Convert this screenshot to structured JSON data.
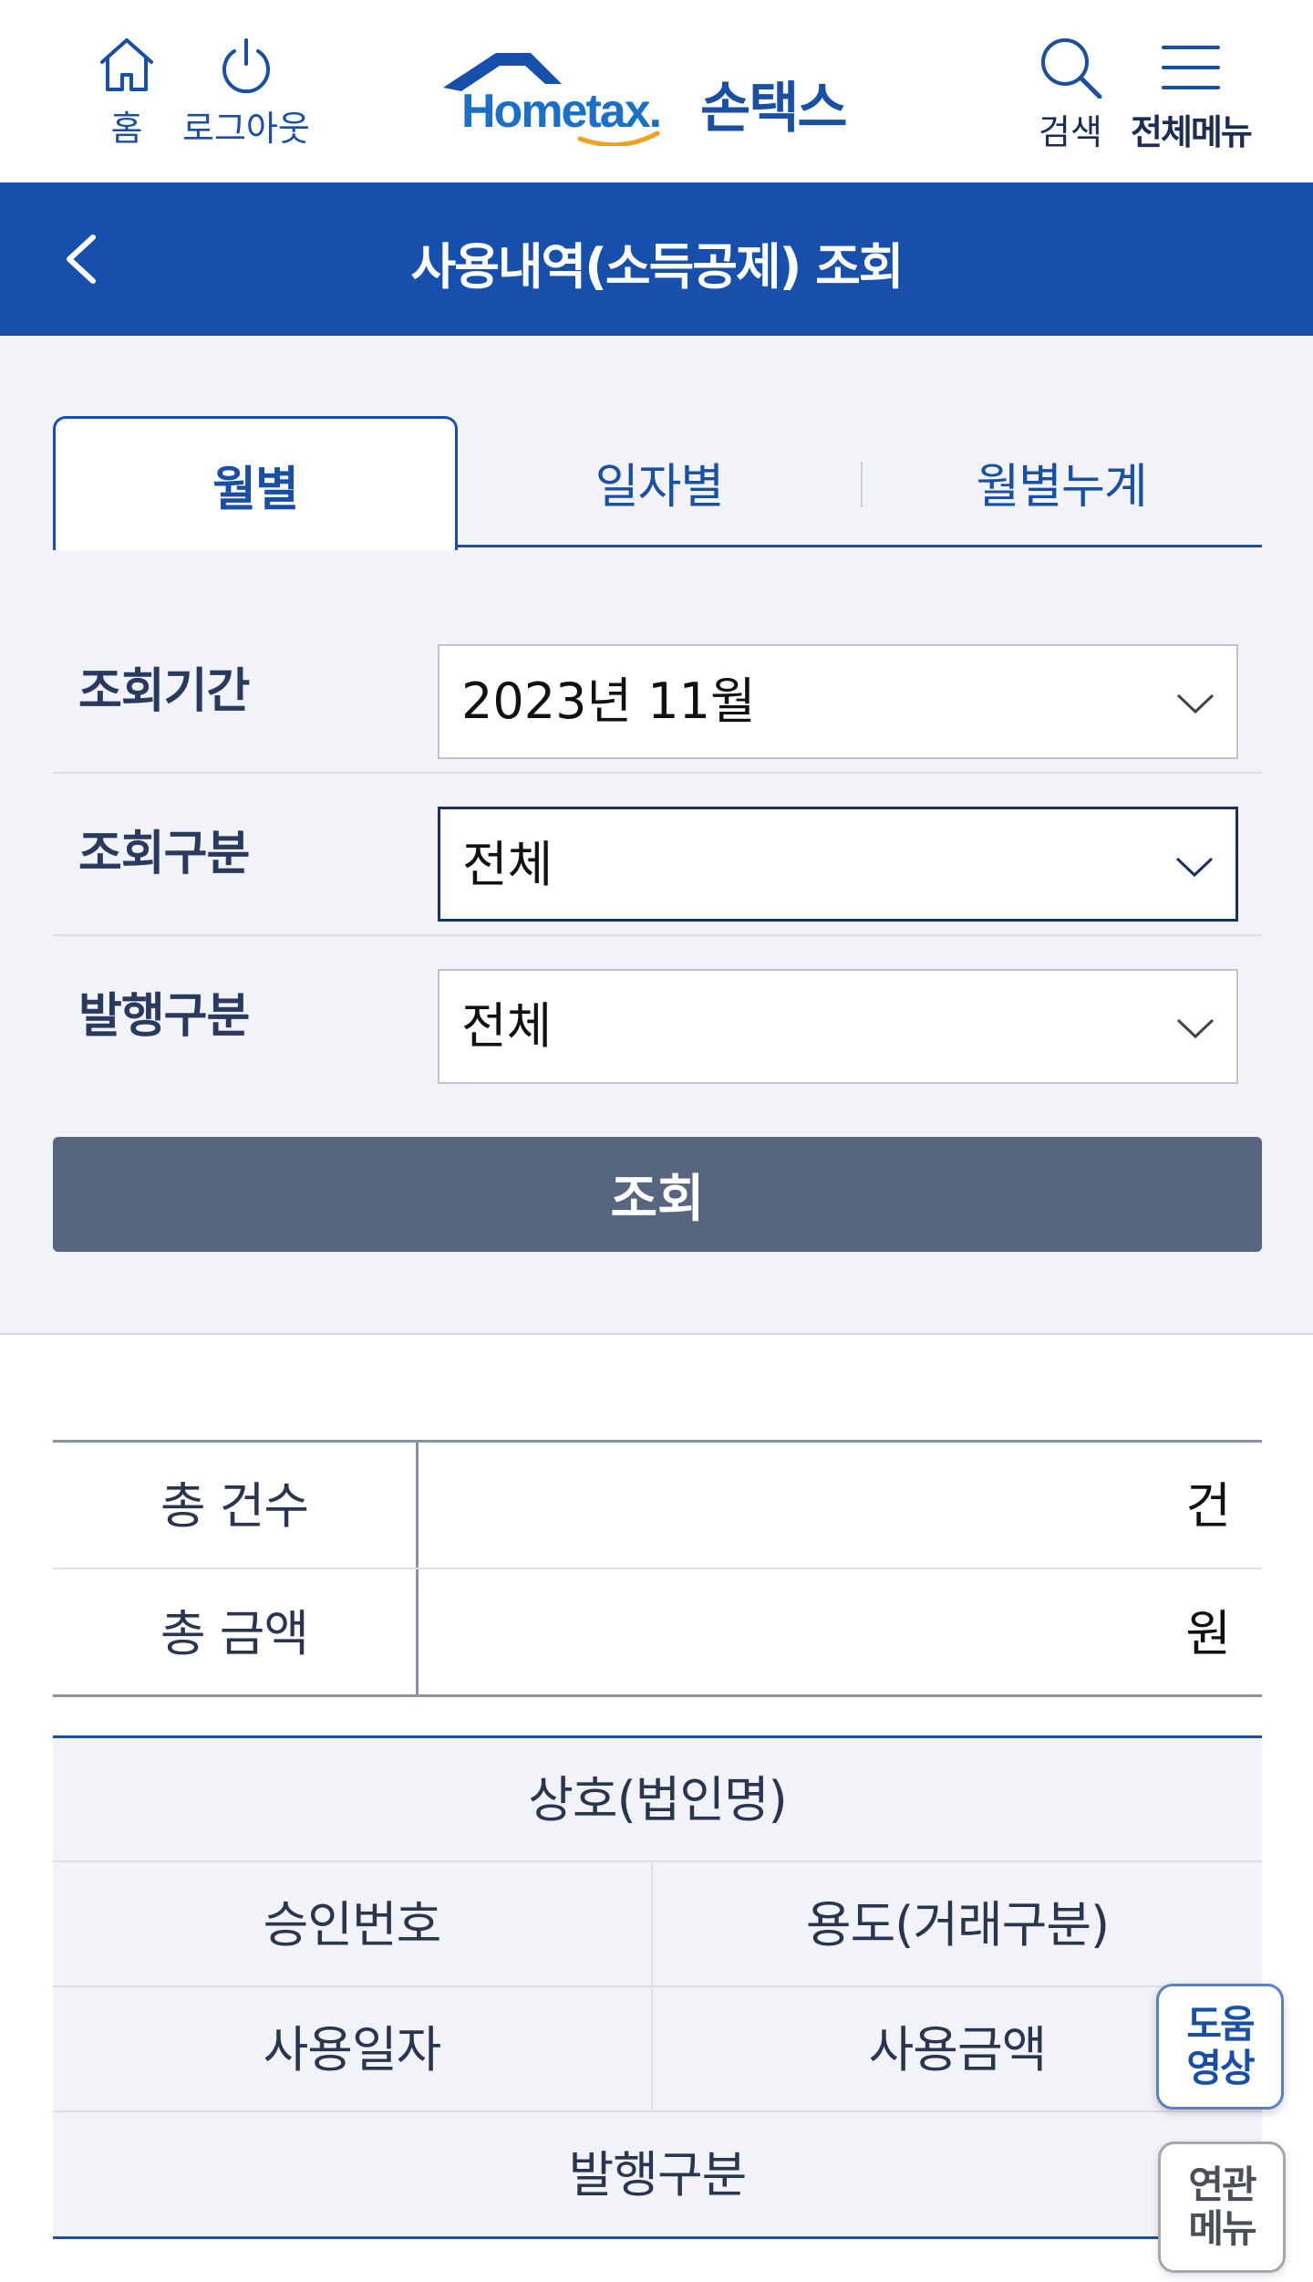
{
  "header": {
    "home_label": "홈",
    "logout_label": "로그아웃",
    "logo_brand": "Hometax.",
    "logo_brand_ko": "손택스",
    "search_label": "검색",
    "menu_label": "전체메뉴"
  },
  "title_bar": {
    "title": "사용내역(소득공제) 조회"
  },
  "tabs": [
    {
      "label": "월별",
      "active": true
    },
    {
      "label": "일자별",
      "active": false
    },
    {
      "label": "월별누계",
      "active": false
    }
  ],
  "filters": {
    "period": {
      "label": "조회기간",
      "value": "2023년 11월"
    },
    "query_type": {
      "label": "조회구분",
      "value": "전체"
    },
    "issue_type": {
      "label": "발행구분",
      "value": "전체"
    }
  },
  "search_button": "조회",
  "summary": {
    "total_count_label": "총 건수",
    "total_count_unit": "건",
    "total_amount_label": "총 금액",
    "total_amount_unit": "원"
  },
  "columns": {
    "merchant": "상호(법인명)",
    "approval_no": "승인번호",
    "usage_type": "용도(거래구분)",
    "usage_date": "사용일자",
    "usage_amount": "사용금액",
    "issue_type": "발행구분"
  },
  "floating": {
    "help_video_line1": "도움",
    "help_video_line2": "영상",
    "related_menu_line1": "연관",
    "related_menu_line2": "메뉴"
  },
  "colors": {
    "primary": "#1650ac",
    "panel_bg": "#f1f3f8",
    "search_button_bg": "#58657e"
  }
}
